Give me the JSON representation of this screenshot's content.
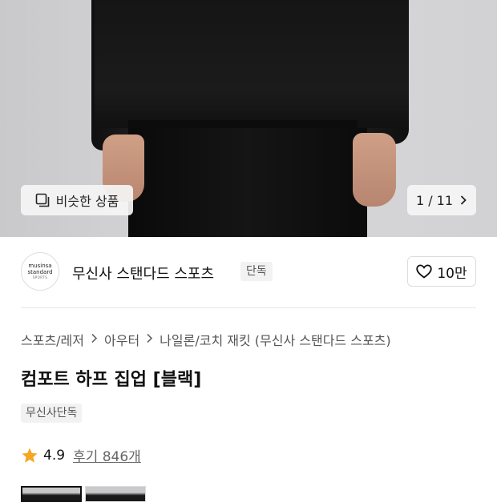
{
  "hero": {
    "similar_label": "비슷한 상품",
    "counter": "1 / 11"
  },
  "brand": {
    "logo_line1": "musinsa",
    "logo_line2": "standard",
    "logo_line3": "SPORTS",
    "name": "무신사 스탠다드 스포츠",
    "badge": "단독",
    "likes": "10만"
  },
  "product": {
    "breadcrumb": [
      "스포츠/레저",
      "아우터",
      "나일론/코치 재킷 (무신사 스탠다드 스포츠)"
    ],
    "title": "컴포트 하프 집업 [블랙]",
    "tag": "무신사단독",
    "rating": "4.9",
    "reviews": "후기 846개"
  },
  "colors": {
    "star": "#f5a623",
    "heart_outline": "#111111"
  }
}
